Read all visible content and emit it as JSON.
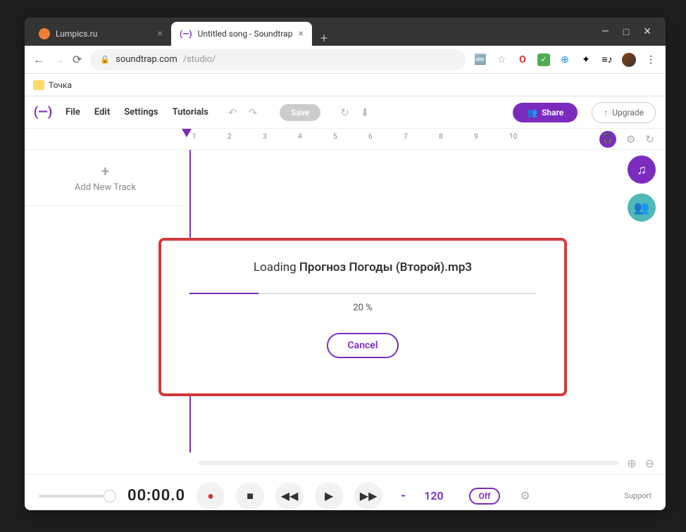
{
  "browser": {
    "tabs": [
      {
        "title": "Lumpics.ru",
        "favicon_color": "#f08030"
      },
      {
        "title": "Untitled song - Soundtrap",
        "favicon_text": "(—)"
      }
    ],
    "url_domain": "soundtrap.com",
    "url_path": "/studio/",
    "bookmark": "Точка"
  },
  "toolbar": {
    "menu": {
      "file": "File",
      "edit": "Edit",
      "settings": "Settings",
      "tutorials": "Tutorials"
    },
    "save": "Save",
    "share": "Share",
    "upgrade": "Upgrade"
  },
  "timeline": {
    "ticks": [
      "1",
      "2",
      "3",
      "4",
      "5",
      "6",
      "7",
      "8",
      "9",
      "10"
    ]
  },
  "tracks": {
    "add_label": "Add New Track"
  },
  "modal": {
    "title_prefix": "Loading ",
    "filename": "Прогноз Погоды (Второй).mp3",
    "percent": "20 %",
    "progress_value": 20,
    "cancel": "Cancel"
  },
  "transport": {
    "time": "00:00.0",
    "bpm": "120",
    "loop": "Off",
    "support": "Support"
  }
}
